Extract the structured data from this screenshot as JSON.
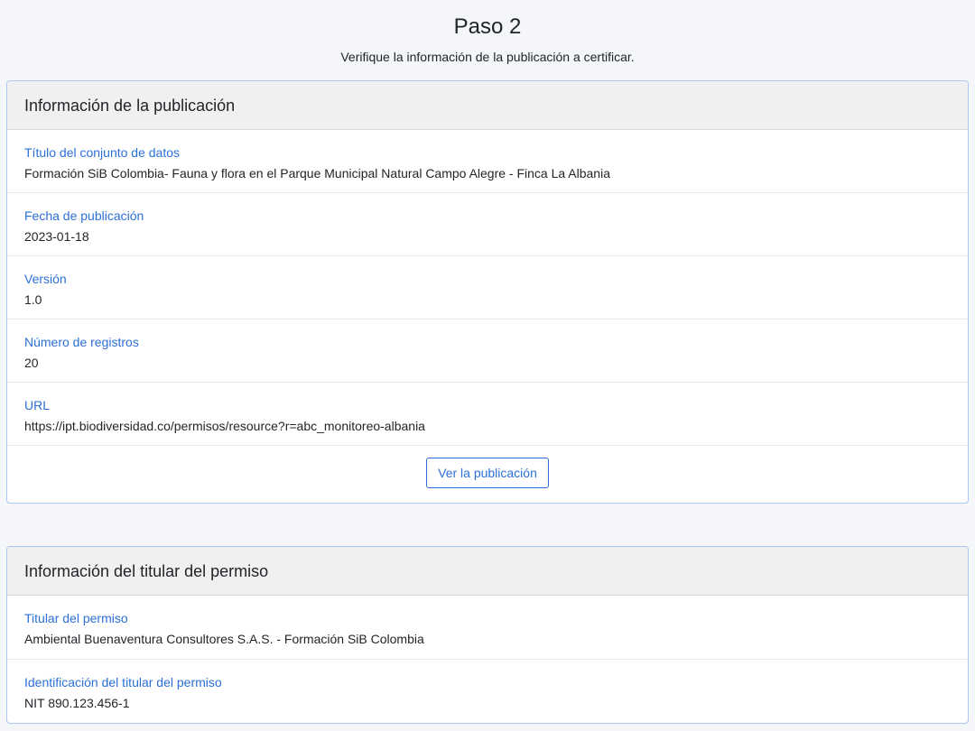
{
  "header": {
    "title": "Paso 2",
    "subtitle": "Verifique la información de la publicación a certificar."
  },
  "publication": {
    "heading": "Información de la publicación",
    "fields": [
      {
        "label": "Título del conjunto de datos",
        "value": "Formación SiB Colombia- Fauna y flora en el Parque Municipal Natural Campo Alegre - Finca La Albania"
      },
      {
        "label": "Fecha de publicación",
        "value": "2023-01-18"
      },
      {
        "label": "Versión",
        "value": "1.0"
      },
      {
        "label": "Número de registros",
        "value": "20"
      },
      {
        "label": "URL",
        "value": "https://ipt.biodiversidad.co/permisos/resource?r=abc_monitoreo-albania"
      }
    ],
    "view_button": "Ver la publicación"
  },
  "holder": {
    "heading": "Información del titular del permiso",
    "fields": [
      {
        "label": "Titular del permiso",
        "value": "Ambiental Buenaventura Consultores S.A.S. - Formación SiB Colombia"
      },
      {
        "label": "Identificación del titular del permiso",
        "value": "NIT 890.123.456-1"
      }
    ]
  },
  "colors": {
    "accent": "#2c6fd6",
    "card_border": "#a9c7f5",
    "header_bg": "#f0f0f0",
    "page_bg": "#f4f6f9"
  }
}
